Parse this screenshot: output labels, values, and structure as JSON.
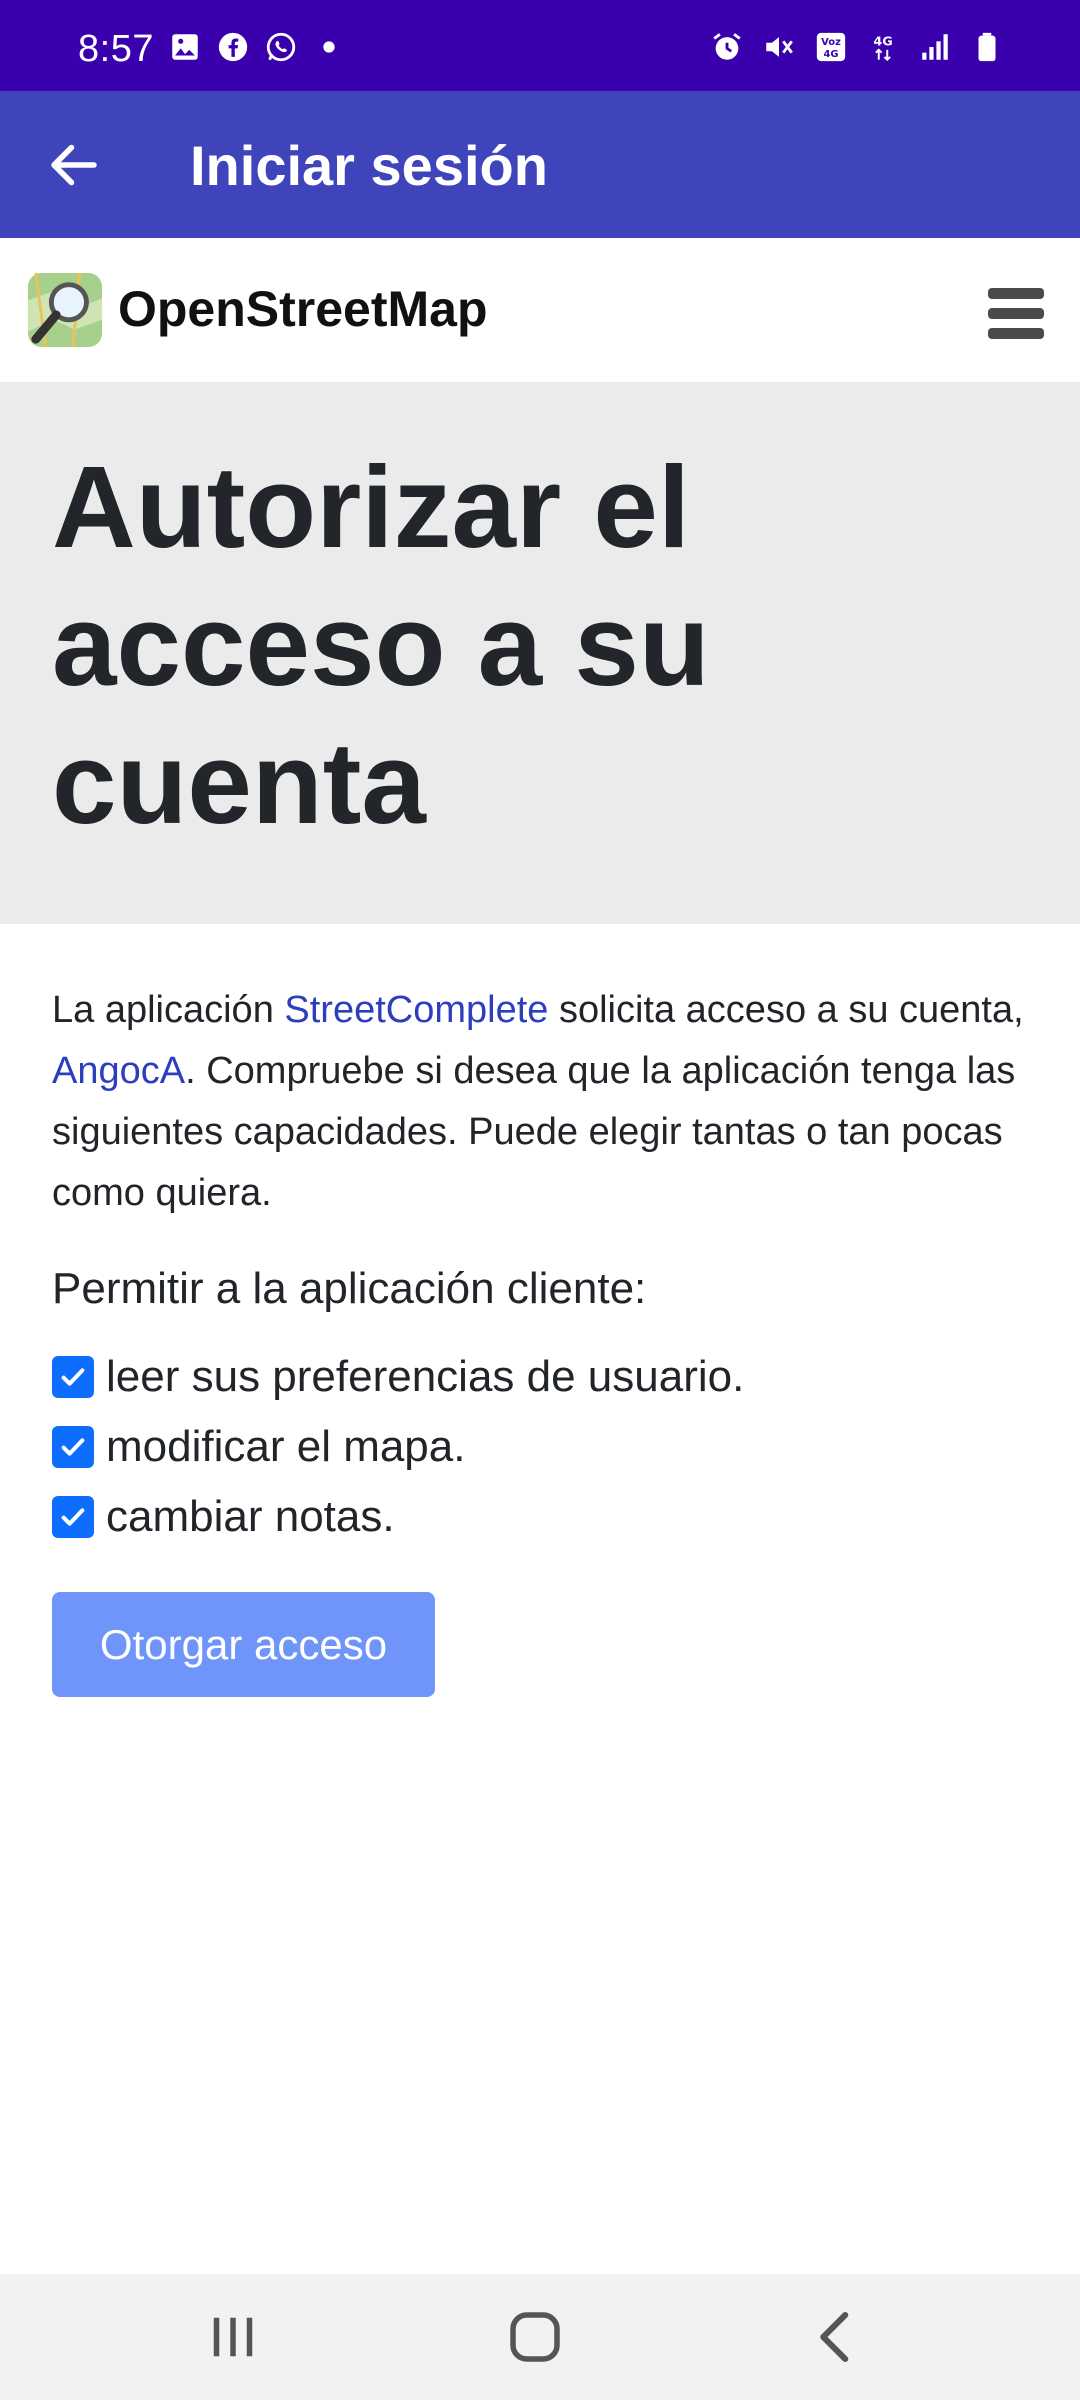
{
  "status_bar": {
    "time": "8:57",
    "icons": [
      "gallery-icon",
      "facebook-icon",
      "whatsapp-icon",
      "dot-icon",
      "alarm-icon",
      "mute-icon",
      "volte-icon",
      "4g-icon",
      "signal-icon",
      "battery-icon"
    ],
    "volte_label": "Voz",
    "network_label": "4G"
  },
  "app_bar": {
    "title": "Iniciar sesión",
    "back_icon": "arrow-back-icon"
  },
  "site_header": {
    "name": "OpenStreetMap",
    "menu_icon": "hamburger-icon"
  },
  "hero": {
    "title": "Autorizar el acceso a su cuenta"
  },
  "intro": {
    "t1": "La aplicación ",
    "app_link": "StreetComplete",
    "t2": " solicita acceso a su cuenta, ",
    "user_link": "AngocA",
    "t3": ". Compruebe si desea que la aplicación tenga las siguientes capacidades. Puede elegir tantas o tan pocas como quiera."
  },
  "permissions": {
    "heading": "Permitir a la aplicación cliente:",
    "items": [
      {
        "label": "leer sus preferencias de usuario.",
        "checked": true
      },
      {
        "label": "modificar el mapa.",
        "checked": true
      },
      {
        "label": "cambiar notas.",
        "checked": true
      }
    ]
  },
  "grant_button": {
    "label": "Otorgar acceso"
  },
  "colors": {
    "status_bar": "#3a00ae",
    "app_bar": "#3f44ba",
    "hero_bg": "#ebebeb",
    "link": "#2c3ebd",
    "checkbox": "#0d6efd",
    "button": "#6f95fb"
  }
}
